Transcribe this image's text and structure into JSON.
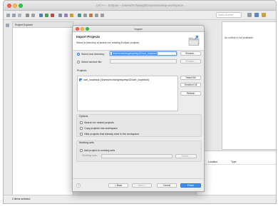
{
  "window": {
    "title": "C/C++ - Eclipse - /Users/mchiang/Documents/esp-workspace",
    "quick_access": "Quick Access"
  },
  "views": {
    "project_explorer": "Project Explorer",
    "outline_message": "An outline is not available.",
    "table_col_location": "Location",
    "table_col_type": "Type",
    "status": "0 items selected"
  },
  "dialog": {
    "title": "Import",
    "heading": "Import Projects",
    "description": "Select a directory to search for existing Eclipse projects.",
    "select_root_label": "Select root directory:",
    "select_root_value": "/Users/mchiang/esp/esp32/uart_loopback",
    "select_archive_label": "Select archive file:",
    "browse_label": "Browse...",
    "projects_label": "Projects:",
    "projects": [
      {
        "name": "uart_loopback (/Users/mchiang/esp/esp32/uart_loopback)",
        "checked": true
      }
    ],
    "select_all": "Select All",
    "deselect_all": "Deselect All",
    "refresh": "Refresh",
    "options_label": "Options",
    "opt_nested": "Search for nested projects",
    "opt_copy": "Copy projects into workspace",
    "opt_hide": "Hide projects that already exist in the workspace",
    "working_sets_label": "Working sets",
    "add_to_working_sets": "Add project to working sets",
    "working_sets_field": "Working sets:",
    "select_btn": "Select...",
    "help": "?",
    "back": "< Back",
    "next": "Next >",
    "cancel": "Cancel",
    "finish": "Finish"
  },
  "colors": {
    "accent": "#3b8ef0",
    "close": "#fc605c",
    "minimize": "#fdbc40",
    "zoom": "#34c84a"
  }
}
